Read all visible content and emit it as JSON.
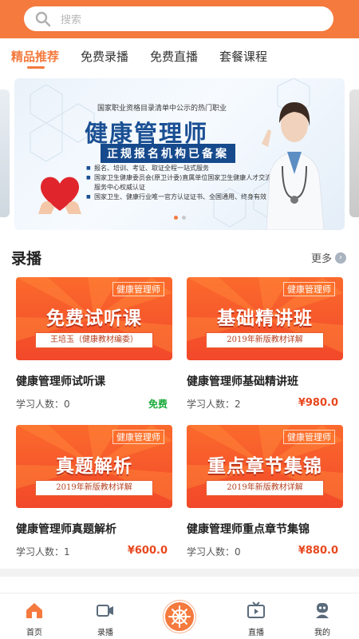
{
  "search": {
    "placeholder": "搜索",
    "icon": "search-icon"
  },
  "tabs": [
    {
      "label": "精品推荐",
      "active": true
    },
    {
      "label": "免费录播",
      "active": false
    },
    {
      "label": "免费直播",
      "active": false
    },
    {
      "label": "套餐课程",
      "active": false
    }
  ],
  "banner": {
    "top_line": "国家职业资格目录清单中公示的热门职业",
    "title": "健康管理师",
    "subtitle": "正规报名机构已备案",
    "lines": [
      "报名、培训、考证、取证全程一站式服务",
      "国家卫生健康委员会(原卫计委)直属单位国家卫生健康人才交流服务中心权威认证",
      "国家卫生、健康行业唯一官方认证证书、全国通用、终身有效"
    ],
    "slide_count": 2,
    "active_slide": 0
  },
  "section": {
    "title": "录播",
    "more_label": "更多"
  },
  "courses": [
    {
      "tag": "健康管理师",
      "banner_text": "免费试听课",
      "ribbon": "王培玉（健康教材编委）",
      "title": "健康管理师试听课",
      "students": "学习人数：0",
      "price": "免费",
      "free": true
    },
    {
      "tag": "健康管理师",
      "banner_text": "基础精讲班",
      "ribbon": "2019年新版教材详解",
      "title": "健康管理师基础精讲班",
      "students": "学习人数：2",
      "price": "¥980.0",
      "free": false
    },
    {
      "tag": "健康管理师",
      "banner_text": "真题解析",
      "ribbon": "2019年新版教材详解",
      "title": "健康管理师真题解析",
      "students": "学习人数：1",
      "price": "¥600.0",
      "free": false
    },
    {
      "tag": "健康管理师",
      "banner_text": "重点章节集锦",
      "ribbon": "2019年新版教材详解",
      "title": "健康管理师重点章节集锦",
      "students": "学习人数：0",
      "price": "¥880.0",
      "free": false
    }
  ],
  "tabbar": [
    {
      "label": "首页",
      "icon": "home-icon",
      "active": true
    },
    {
      "label": "录播",
      "icon": "video-icon",
      "active": false
    },
    {
      "label": "",
      "icon": "wheel-icon",
      "active": false
    },
    {
      "label": "直播",
      "icon": "tv-icon",
      "active": false
    },
    {
      "label": "我的",
      "icon": "profile-icon",
      "active": false
    }
  ],
  "colors": {
    "accent": "#f47a3e",
    "price": "#e8481f",
    "free": "#1aaa3a",
    "banner_title": "#1a4f93"
  }
}
